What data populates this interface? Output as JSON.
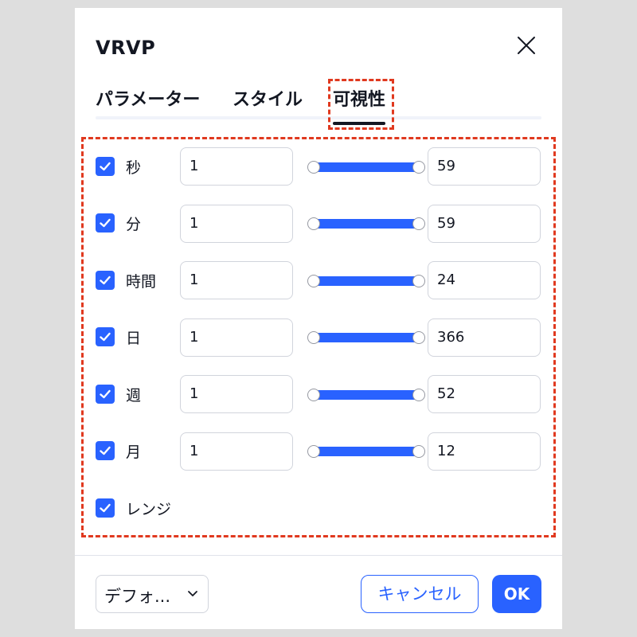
{
  "dialog": {
    "title": "VRVP",
    "tabs": [
      {
        "label": "パラメーター"
      },
      {
        "label": "スタイル"
      },
      {
        "label": "可視性",
        "active": true
      }
    ]
  },
  "rows": [
    {
      "label": "秒",
      "checked": true,
      "min": "1",
      "max": "59"
    },
    {
      "label": "分",
      "checked": true,
      "min": "1",
      "max": "59"
    },
    {
      "label": "時間",
      "checked": true,
      "min": "1",
      "max": "24"
    },
    {
      "label": "日",
      "checked": true,
      "min": "1",
      "max": "366"
    },
    {
      "label": "週",
      "checked": true,
      "min": "1",
      "max": "52"
    },
    {
      "label": "月",
      "checked": true,
      "min": "1",
      "max": "12"
    }
  ],
  "range": {
    "label": "レンジ",
    "checked": true
  },
  "footer": {
    "template_label": "デフォ...",
    "cancel_label": "キャンセル",
    "ok_label": "OK"
  },
  "colors": {
    "accent": "#2962ff",
    "highlight": "#e0391f",
    "text": "#131722"
  }
}
